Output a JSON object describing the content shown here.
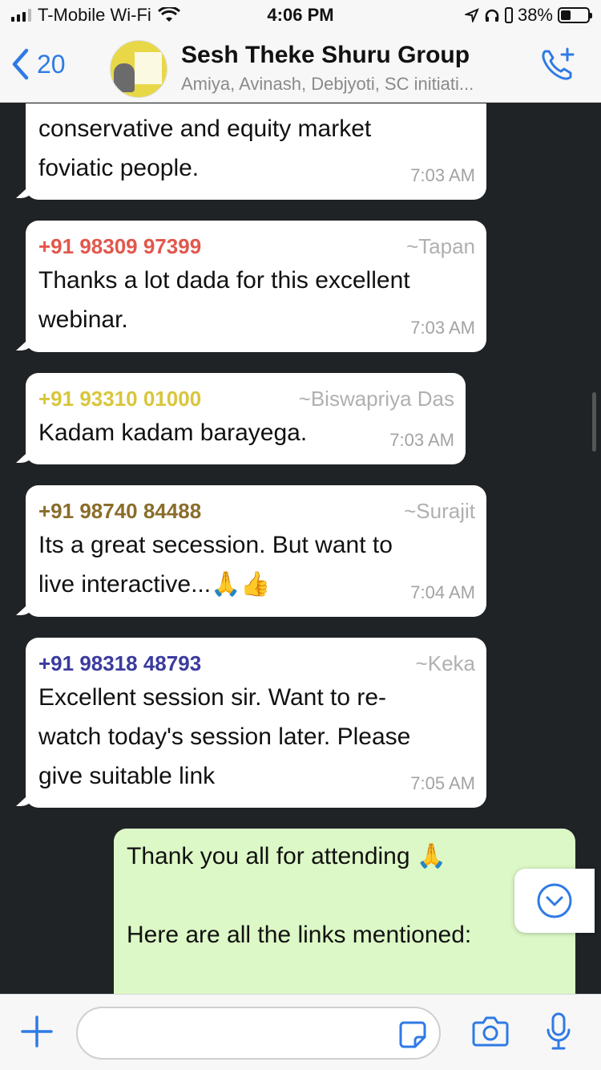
{
  "status_bar": {
    "carrier": "T-Mobile Wi-Fi",
    "time": "4:06 PM",
    "battery": "38%",
    "battery_level": 0.38
  },
  "header": {
    "back_count": "20",
    "title": "Sesh Theke Shuru Group",
    "subtitle": "Amiya, Avinash, Debjyoti, SC initiati..."
  },
  "messages": [
    {
      "lines": [
        "conservative and equity market",
        "foviatic people."
      ],
      "time": "7:03 AM"
    },
    {
      "sender": "+91 98309 97399",
      "alias": "~Tapan",
      "sender_color": "#e2574c",
      "lines": [
        "Thanks a lot dada for this excellent",
        "webinar."
      ],
      "time": "7:03 AM"
    },
    {
      "sender": "+91 93310 01000",
      "alias": "~Biswapriya Das",
      "sender_color": "#d8c63c",
      "lines": [
        "Kadam kadam barayega."
      ],
      "time": "7:03 AM"
    },
    {
      "sender": "+91 98740 84488",
      "alias": "~Surajit",
      "sender_color": "#8a6d2a",
      "lines": [
        "Its a great secession. But want to",
        "live interactive...🙏👍"
      ],
      "time": "7:04 AM"
    },
    {
      "sender": "+91 98318 48793",
      "alias": "~Keka",
      "sender_color": "#3b3b9e",
      "lines": [
        "Excellent session sir. Want to re-",
        "watch today's session later. Please",
        "give suitable link"
      ],
      "time": "7:05 AM"
    }
  ],
  "outgoing": {
    "line1": "Thank you all for attending 🙏",
    "line2": "Here are all the links mentioned:"
  },
  "icons": {
    "back": "chevron-left-icon",
    "call": "add-call-icon",
    "scroll": "scroll-down-icon",
    "attach": "plus-icon",
    "sticker": "sticker-icon",
    "camera": "camera-icon",
    "mic": "microphone-icon"
  },
  "colors": {
    "accent": "#2f7ae5",
    "outgoing_bubble": "#dcf8c6",
    "chat_background": "#1f2326"
  }
}
